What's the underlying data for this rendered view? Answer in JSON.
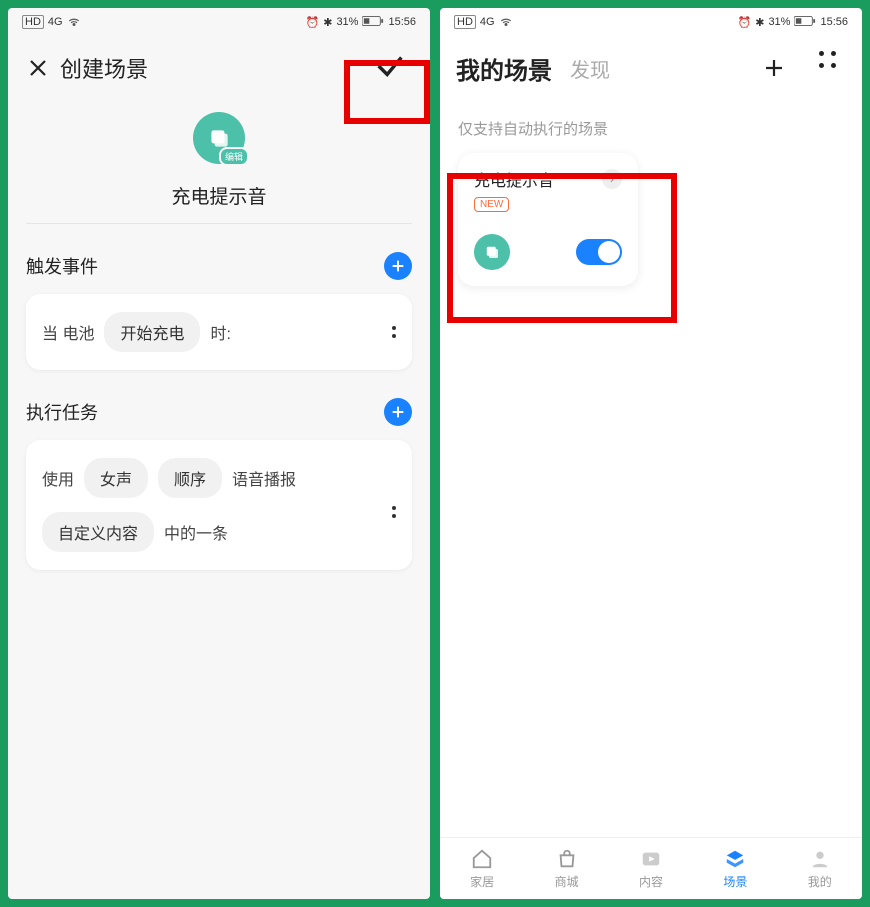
{
  "status": {
    "hd": "HD",
    "net": "4G",
    "alarm": "⏰",
    "bt": "✱",
    "battery_pct": "31%",
    "time": "15:56"
  },
  "left": {
    "title": "创建场景",
    "scene_name": "充电提示音",
    "edit_label": "编辑",
    "trigger": {
      "section_title": "触发事件",
      "txt_before": "当 电池",
      "chip": "开始充电",
      "txt_after": "时:"
    },
    "task": {
      "section_title": "执行任务",
      "use_txt": "使用",
      "chip_voice": "女声",
      "chip_order": "顺序",
      "tts_txt": "语音播报",
      "chip_custom": "自定义内容",
      "tail_txt": "中的一条"
    }
  },
  "right": {
    "title": "我的场景",
    "discover": "发现",
    "hint": "仅支持自动执行的场景",
    "card": {
      "title": "充电提示音",
      "new_badge": "NEW"
    },
    "nav": {
      "home": "家居",
      "mall": "商城",
      "content": "内容",
      "scene": "场景",
      "mine": "我的"
    }
  }
}
